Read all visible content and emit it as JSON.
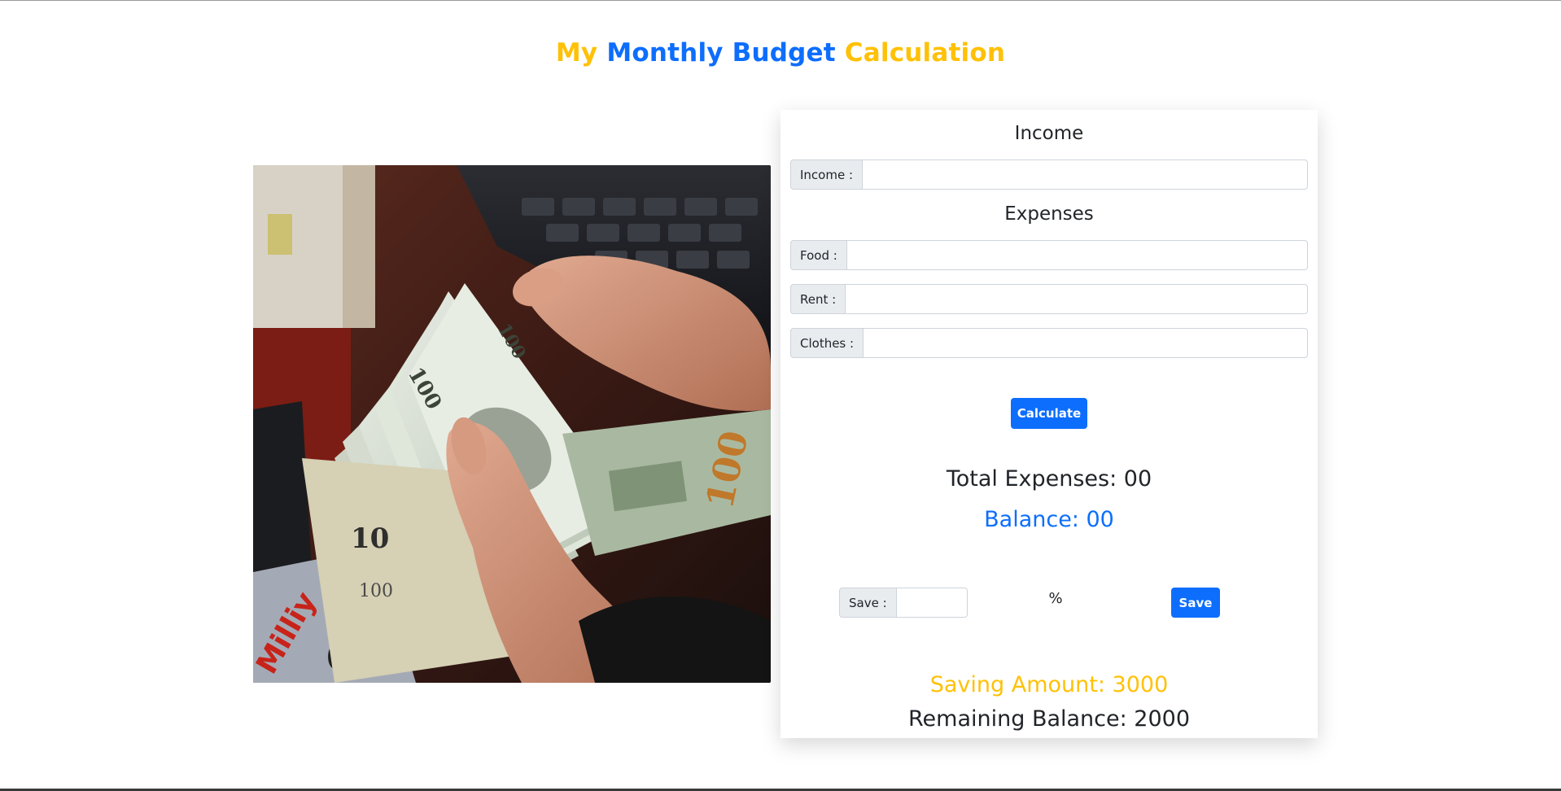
{
  "header": {
    "title_part1": "My",
    "title_part2": "Monthly Budget",
    "title_part3": "Calculation"
  },
  "colors": {
    "primary": "#0d6efd",
    "warning": "#ffc107",
    "text": "#212529"
  },
  "image": {
    "icon": "money-cash-photo"
  },
  "income": {
    "section_title": "Income",
    "label": "Income :",
    "value": ""
  },
  "expenses": {
    "section_title": "Expenses",
    "food_label": "Food :",
    "food_value": "",
    "rent_label": "Rent :",
    "rent_value": "",
    "clothes_label": "Clothes :",
    "clothes_value": ""
  },
  "actions": {
    "calculate_label": "Calculate",
    "save_label": "Save"
  },
  "results": {
    "total_expenses": "Total Expenses: 00",
    "balance": "Balance: 00",
    "saving_amount": "Saving Amount: 3000",
    "remaining_balance": "Remaining Balance: 2000"
  },
  "save": {
    "label": "Save :",
    "value": "",
    "percent_symbol": "%"
  }
}
